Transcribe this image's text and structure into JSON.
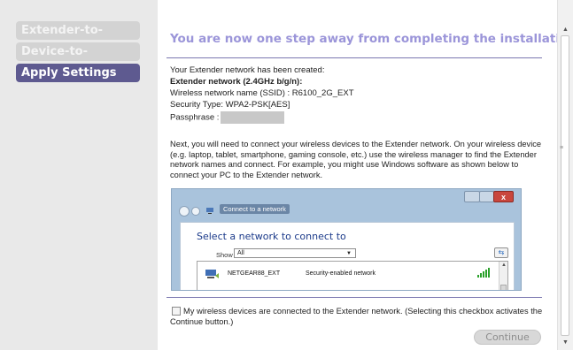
{
  "sidebar": {
    "steps": [
      {
        "label": "Extender-to-Router",
        "state": "done"
      },
      {
        "label": "Device-to-Extender",
        "state": "done"
      },
      {
        "label": "Apply Settings",
        "state": "active"
      }
    ]
  },
  "main": {
    "heading": "You are now one step away from completing the installation.",
    "created_text": "Your Extender network has been created:",
    "network_band": "Extender network (2.4GHz b/g/n):",
    "ssid_line": "Wireless network name (SSID) : R6100_2G_EXT",
    "security_line": "Security Type: WPA2-PSK[AES]",
    "passphrase_label": "Passphrase :",
    "instructions": "Next, you will need to connect your wireless devices to the Extender network. On your wireless device (e.g. laptop, tablet, smartphone, gaming console, etc.) use the wireless manager to find the Extender network names and connect. For example, you might use Windows software as shown below to connect your PC to the Extender network.",
    "confirm_label": "My wireless devices are connected to the Extender network. (Selecting this checkbox activates the Continue button.)",
    "confirm_checked": false,
    "continue_label": "Continue",
    "continue_enabled": false
  },
  "example_screenshot": {
    "close_glyph": "x",
    "breadcrumb": "Connect to a network",
    "title": "Select a network to connect to",
    "show_label": "Show",
    "show_value": "All",
    "network_name": "NETGEAR88_EXT",
    "network_security": "Security-enabled network",
    "icons": [
      "back-icon",
      "forward-icon",
      "network-icon",
      "refresh-icon",
      "wifi-signal-icon"
    ]
  },
  "colors": {
    "heading": "#9b95d9",
    "active_step": "#5e5a90",
    "done_step": "#d3d3d3",
    "sidebar_bg": "#e9e9e9",
    "rule": "#7b77b0"
  }
}
